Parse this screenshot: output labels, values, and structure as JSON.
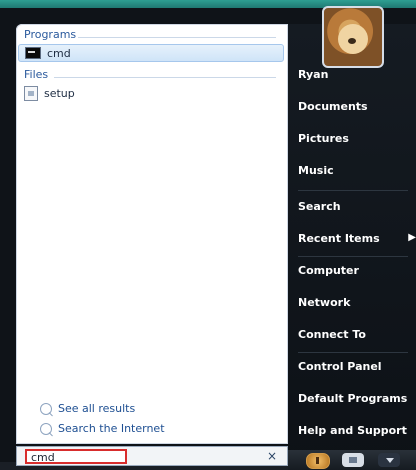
{
  "start_menu": {
    "left": {
      "programs_header": "Programs",
      "programs_items": [
        {
          "label": "cmd",
          "icon": "cmd-icon",
          "selected": true
        }
      ],
      "files_header": "Files",
      "files_items": [
        {
          "label": "setup",
          "icon": "file-icon"
        }
      ],
      "links": {
        "see_all_results": "See all results",
        "search_internet": "Search the Internet"
      },
      "search": {
        "value": "cmd",
        "clear_symbol": "×"
      }
    },
    "right": {
      "user_name": "Ryan",
      "items": [
        "Documents",
        "Pictures",
        "Music",
        "Search",
        "Recent Items",
        "Computer",
        "Network",
        "Connect To",
        "Control Panel",
        "Default Programs",
        "Help and Support"
      ],
      "recent_items_arrow": "▶"
    }
  }
}
